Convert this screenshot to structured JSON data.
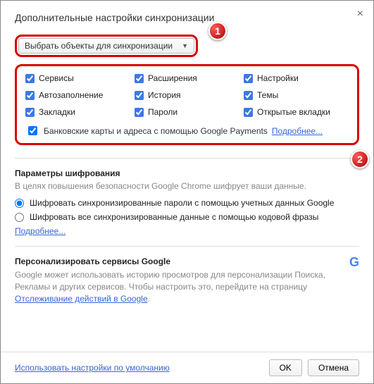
{
  "title": "Дополнительные настройки синхронизации",
  "dropdown": {
    "label": "Выбрать объекты для синхронизации"
  },
  "badges": {
    "step1": "1",
    "step2": "2"
  },
  "sync": {
    "items": [
      {
        "label": "Сервисы",
        "checked": true
      },
      {
        "label": "Расширения",
        "checked": true
      },
      {
        "label": "Настройки",
        "checked": true
      },
      {
        "label": "Автозаполнение",
        "checked": true
      },
      {
        "label": "История",
        "checked": true
      },
      {
        "label": "Темы",
        "checked": true
      },
      {
        "label": "Закладки",
        "checked": true
      },
      {
        "label": "Пароли",
        "checked": true
      },
      {
        "label": "Открытые вкладки",
        "checked": true
      }
    ],
    "payments": {
      "label": "Банковские карты и адреса с помощью Google Payments",
      "checked": true,
      "more": "Подробнее..."
    }
  },
  "encryption": {
    "title": "Параметры шифрования",
    "subtitle": "В целях повышения безопасности Google Chrome шифрует ваши данные.",
    "opt1": "Шифровать синхронизированные пароли с помощью учетных данных Google",
    "opt2": "Шифровать все синхронизированные данные с помощью кодовой фразы",
    "more": "Подробнее..."
  },
  "personalize": {
    "title": "Персонализировать сервисы Google",
    "text": "Google может использовать историю просмотров для персонализации Поиска, Рекламы и других сервисов. Чтобы настроить это, перейдите на страницу ",
    "link": "Отслеживание действий в Google",
    "dot": "."
  },
  "footer": {
    "reset": "Использовать настройки по умолчанию",
    "ok": "OK",
    "cancel": "Отмена"
  }
}
